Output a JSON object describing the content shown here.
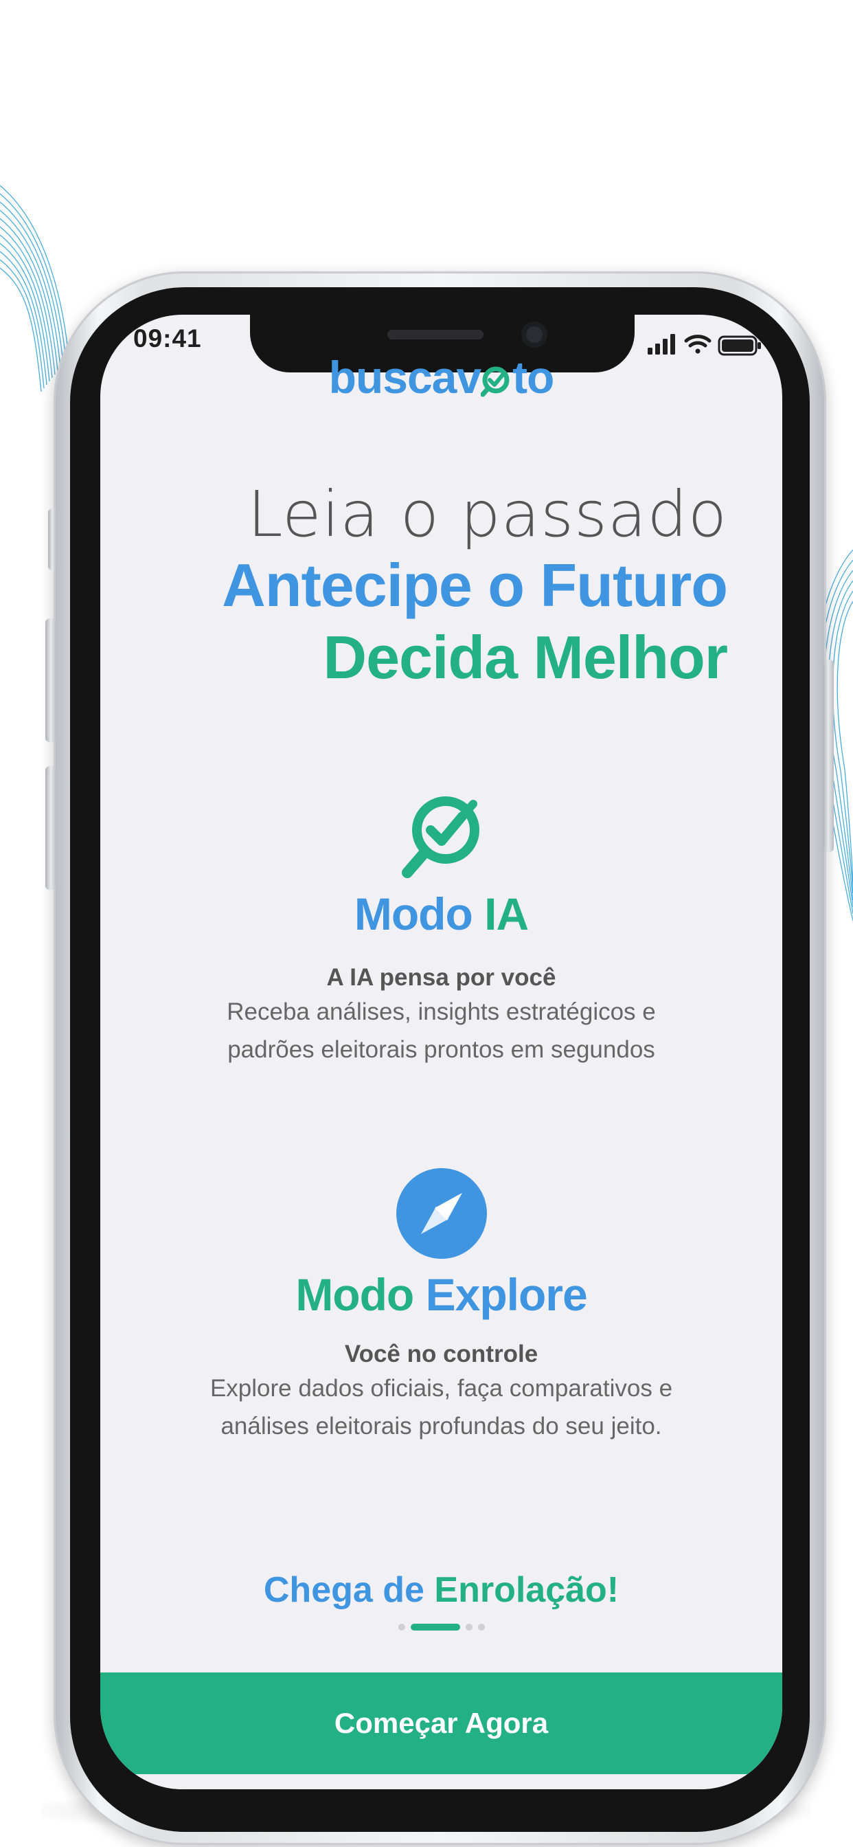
{
  "status_bar": {
    "time": "09:41",
    "icons": [
      "cellular-signal-icon",
      "wifi-icon",
      "battery-icon"
    ]
  },
  "app": {
    "logo_text": "buscav",
    "logo_text_end": "to"
  },
  "hero": {
    "line1": "Leia o passado",
    "line2": "Antecipe o Futuro",
    "line3": "Decida Melhor"
  },
  "mode_ia": {
    "icon": "search-check-icon",
    "title_word1": "Modo",
    "title_word2": "IA",
    "subtitle": "A IA pensa por você",
    "desc_line1": "Receba análises, insights estratégicos e",
    "desc_line2": "padrões eleitorais prontos em segundos"
  },
  "mode_explore": {
    "icon": "compass-icon",
    "title_word1": "Modo",
    "title_word2": "Explore",
    "subtitle": "Você no controle",
    "desc_line1": "Explore dados oficiais, faça comparativos e",
    "desc_line2": "análises eleitorais profundas do seu jeito."
  },
  "tagline": {
    "part1": "Chega de",
    "part2": "Enrolação!"
  },
  "pager": {
    "pages": 4,
    "current": 2
  },
  "cta": {
    "start_label": "Começar Agora"
  },
  "colors": {
    "blue": "#3f95df",
    "green": "#23b083",
    "screen_bg": "#f1f1f5",
    "bezel": "#141414"
  }
}
